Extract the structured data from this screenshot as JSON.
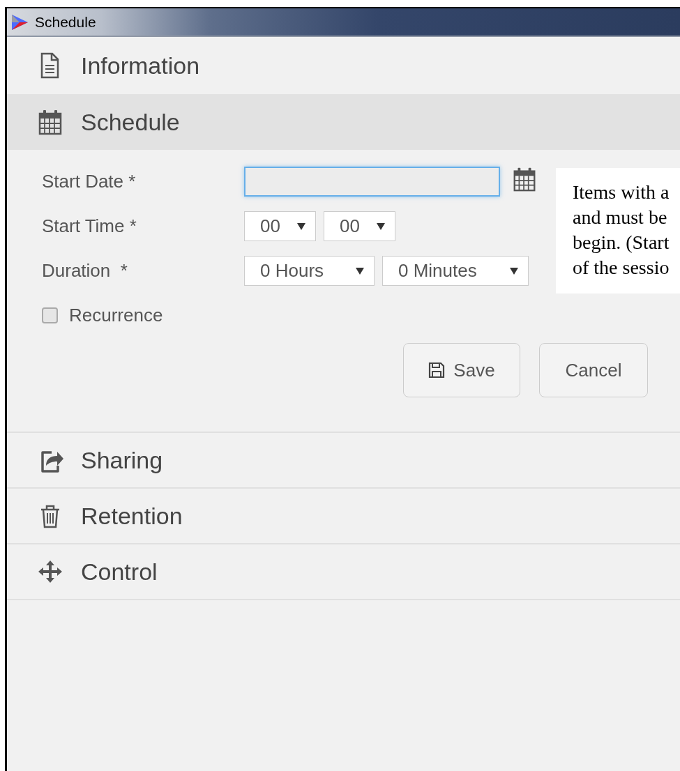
{
  "window": {
    "title": "Schedule"
  },
  "sections": [
    {
      "kind": "document",
      "title": "Information",
      "expanded": false
    },
    {
      "kind": "calendar",
      "title": "Schedule",
      "expanded": true
    },
    {
      "kind": "share",
      "title": "Sharing",
      "expanded": false
    },
    {
      "kind": "trash",
      "title": "Retention",
      "expanded": false
    },
    {
      "kind": "move",
      "title": "Control",
      "expanded": false
    }
  ],
  "schedule_form": {
    "fields": [
      {
        "kind": "date",
        "label": "Start Date *",
        "focused": true
      },
      {
        "kind": "selects",
        "label": "Start Time *",
        "selects": [
          {
            "value": "00"
          },
          {
            "value": "00"
          }
        ]
      },
      {
        "kind": "selects",
        "label": "Duration  *",
        "selects": [
          {
            "value": "0 Hours"
          },
          {
            "value": "0 Minutes"
          }
        ]
      }
    ],
    "recurrence": {
      "label": "Recurrence",
      "checked": false
    },
    "buttons": [
      {
        "kind": "save",
        "label": "Save"
      },
      {
        "kind": "plain",
        "label": "Cancel"
      }
    ],
    "note": {
      "lines": [
        "Items with a",
        "and must be",
        "begin. (Start",
        "of the sessio"
      ]
    }
  }
}
